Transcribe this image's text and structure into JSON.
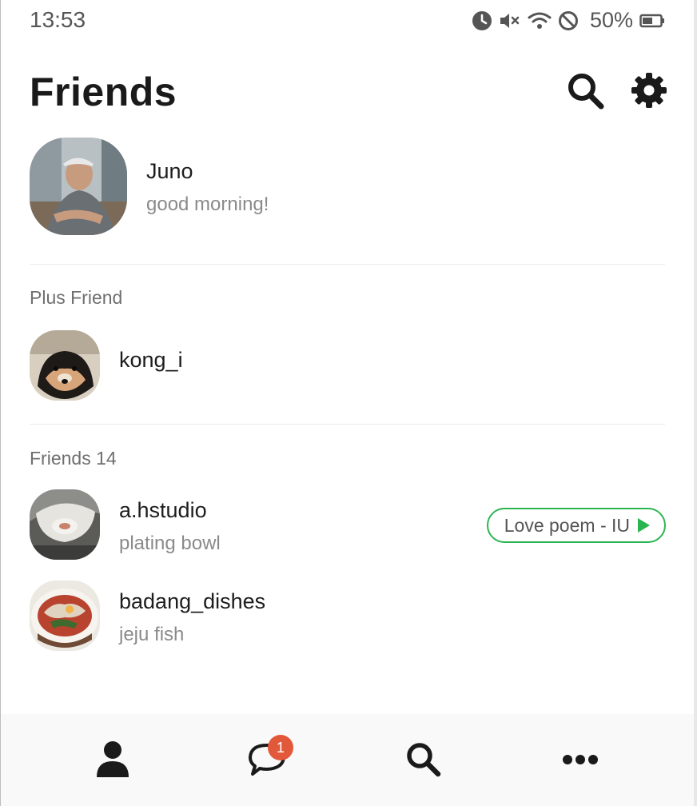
{
  "status_bar": {
    "time": "13:53",
    "battery": "50%",
    "icons": [
      "alarm-icon",
      "mute-icon",
      "wifi-icon",
      "do-not-disturb-icon",
      "battery-icon"
    ]
  },
  "header": {
    "title": "Friends",
    "actions": [
      "search-icon",
      "gear-icon"
    ]
  },
  "my_profile": {
    "name": "Juno",
    "status": "good morning!"
  },
  "plus_friend": {
    "section_label": "Plus Friend",
    "items": [
      {
        "name": "kong_i"
      }
    ]
  },
  "friends": {
    "section_label": "Friends 14",
    "items": [
      {
        "name": "a.hstudio",
        "status": "plating bowl",
        "music": "Love poem - IU"
      },
      {
        "name": "badang_dishes",
        "status": "jeju fish"
      }
    ]
  },
  "tabbar": {
    "tabs": [
      "person-icon",
      "chat-bubble-icon",
      "search-icon",
      "more-icon"
    ],
    "chat_badge": "1"
  },
  "colors": {
    "accent_green": "#2bb552",
    "badge_red": "#e2583a",
    "text_dark": "#1a1a1a",
    "text_muted": "#8a8a8a"
  }
}
